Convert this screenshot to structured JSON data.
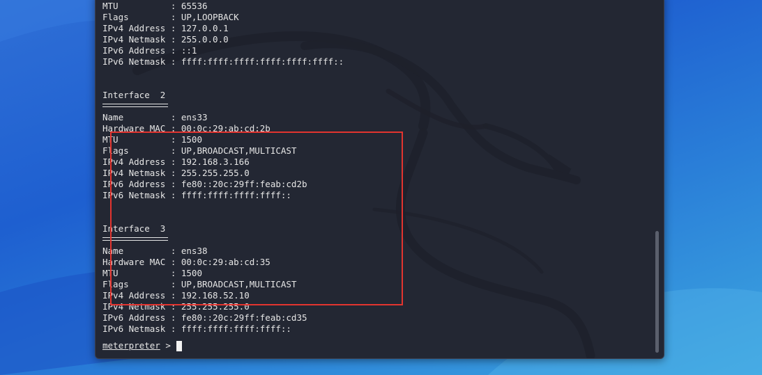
{
  "terminal": {
    "lines": [
      "MTU          : 65536",
      "Flags        : UP,LOOPBACK",
      "IPv4 Address : 127.0.0.1",
      "IPv4 Netmask : 255.0.0.0",
      "IPv6 Address : ::1",
      "IPv6 Netmask : ffff:ffff:ffff:ffff:ffff:ffff::",
      "",
      "",
      "Interface  2",
      "=UNDERLINE=",
      "Name         : ens33",
      "Hardware MAC : 00:0c:29:ab:cd:2b",
      "MTU          : 1500",
      "Flags        : UP,BROADCAST,MULTICAST",
      "IPv4 Address : 192.168.3.166",
      "IPv4 Netmask : 255.255.255.0",
      "IPv6 Address : fe80::20c:29ff:feab:cd2b",
      "IPv6 Netmask : ffff:ffff:ffff:ffff::",
      "",
      "",
      "Interface  3",
      "=UNDERLINE=",
      "Name         : ens38",
      "Hardware MAC : 00:0c:29:ab:cd:35",
      "MTU          : 1500",
      "Flags        : UP,BROADCAST,MULTICAST",
      "IPv4 Address : 192.168.52.10",
      "IPv4 Netmask : 255.255.255.0",
      "IPv6 Address : fe80::20c:29ff:feab:cd35",
      "IPv6 Netmask : ffff:ffff:ffff:ffff::"
    ],
    "prompt": "meterpreter",
    "prompt_symbol": ">"
  },
  "colors": {
    "terminal_bg": "#232733",
    "text": "#e6e6e6",
    "highlight": "#e3342f"
  },
  "icons": {
    "watermark": "kali-dragon-icon"
  }
}
